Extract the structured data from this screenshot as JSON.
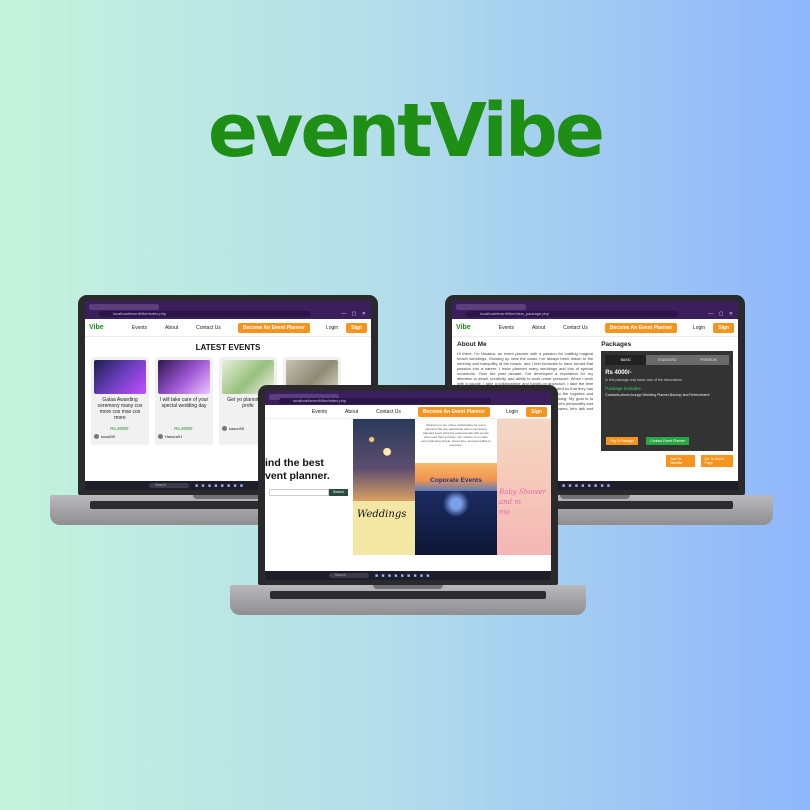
{
  "brand": {
    "title": "eventVibe",
    "color": "#1e8e14"
  },
  "nav": {
    "logo": "entVibe",
    "logo_partial": "Vibe",
    "events": "Events",
    "about": "About",
    "contact": "Contact Us",
    "cta": "Become An Event Planner",
    "login": "Login",
    "signup": "Sign"
  },
  "browser": {
    "url_left": "localhost/eventVibe/index.php",
    "url_right": "localhost/eventVibe/view_package.php",
    "url_center": "localhost/eventVibe/index.php"
  },
  "taskbar": {
    "search": "Search"
  },
  "latest": {
    "title": "LATEST EVENTS",
    "cards": [
      {
        "title": "Galaa Awarding ceremony many cos more cos mas cos more",
        "price": "Rs.4000/-",
        "user": "kusal95",
        "img": "linear-gradient(135deg,#1b1f4a,#6b3fbf 50%,#c24fff)"
      },
      {
        "title": "I will take care of your special wedding day",
        "price": "Rs.4000/-",
        "user": "Hasura01",
        "img": "linear-gradient(135deg,#2b164e,#a25ad8 55%,#eec3ff)"
      },
      {
        "title": "Get yo plannin cak profe",
        "price": "",
        "user": "kasun95",
        "img": "linear-gradient(135deg,#e8f0da,#97c07d 55%,#f7f3e8)"
      },
      {
        "title": "",
        "price": "",
        "user": "",
        "img": "linear-gradient(135deg,#c7c1b2,#8c8a75 55%,#d9d4c5)"
      }
    ]
  },
  "about": {
    "heading": "About Me",
    "text": "Hi there, I'm Nisaara, an event planner with a passion for crafting magical beach weddings. Growing up near the coast, I've always been drawn to the serenity and tranquility of the beach, and I feel fortunate to have turned that passion into a career. I have planned many weddings and lots of special occasions. Over the past decade, I've developed a reputation for my attention to detail, creativity, and ability to work under pressure. When I work with a couple, I take a collaborative and hands-on approach. I take the time to understand their vision and ensure every detail is handled so that they can relax and enjoy the day. From the design and decor to the logistics and vendor management, I handle all aspects of event planning. My goal is to create an unforgettable experience that reflects every client's personality and style. If you're looking for a wedding planner who truly cares, let's talk and start planning the celebration of your dreams together."
  },
  "packages": {
    "heading": "Packages",
    "tabs": [
      "BASIC",
      "STANDARD",
      "PREMIUM"
    ],
    "price": "Rs 4000/-",
    "note": "In this package only basic care of the decorations",
    "includes_label": "Package Includes",
    "includes": "Cocktails,dinner,lounge,Wedding Planner,Backup and Refreshment",
    "btn_contact": "Pay & Package",
    "btn_contact_planner": "Contact Event Planner",
    "btn_add": "Add To Wishlist",
    "btn_home": "Go To Home Page"
  },
  "hero": {
    "line1": "ind the best",
    "line2": "vent planner.",
    "search_btn": "Search",
    "weddings": "Weddings",
    "corporate": "Coporate Events",
    "corporate_text": "Welcome to our online marketplace for event planners! We are passionate about connecting talented event planning professionals with people who need their services. Our mission is to make event planning simple, stress-free, and accessible to everyone.",
    "baby_line1": "Baby Shower",
    "baby_line2": "and m",
    "baby_line3": "mo"
  }
}
